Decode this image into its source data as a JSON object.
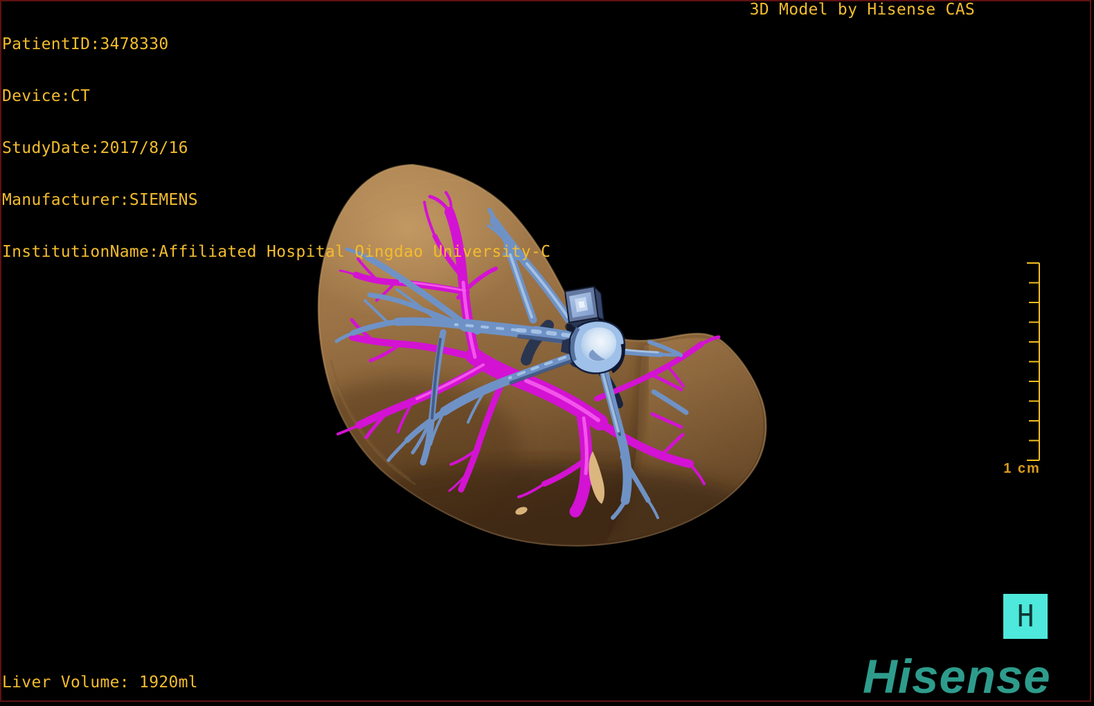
{
  "patient_info": {
    "patient_id": "PatientID:3478330",
    "device": "Device:CT",
    "study_date": "StudyDate:2017/8/16",
    "manufacturer": "Manufacturer:SIEMENS",
    "institution": "InstitutionName:Affiliated Hospital Qingdao University-C"
  },
  "header": {
    "title": "3D Model by Hisense CAS"
  },
  "footer": {
    "liver_volume": "Liver Volume: 1920ml"
  },
  "scale_bar": {
    "label": "1 cm",
    "tick_count": 11
  },
  "branding": {
    "h_badge": "H",
    "logo": "Hisense"
  },
  "model": {
    "organ": "liver",
    "structures": [
      "liver-surface",
      "portal-vein-tree",
      "hepatic-vein-tree",
      "vena-cava-marker-cube",
      "vena-cava-opening"
    ]
  },
  "colors": {
    "overlay_text": "#F3BC2E",
    "ruler": "#F2BE1E",
    "ruler_label": "#DC9C1C",
    "badge_bg": "#4EE9DC",
    "badge_glyph": "#0C3734",
    "logo": "#2E9C8C",
    "frame_border": "#5E1111",
    "background": "#000000",
    "liver_surface": "#9A7345",
    "portal_vein": "#D312D3",
    "hepatic_vein": "#6F92C6"
  }
}
